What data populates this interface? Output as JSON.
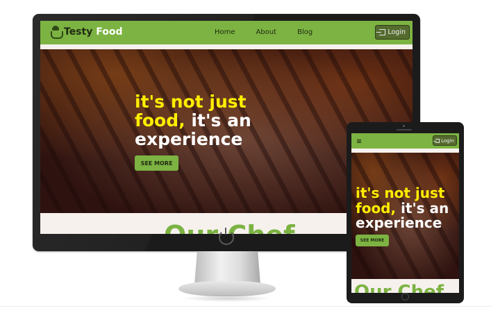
{
  "site": {
    "brand_primary": "Testy",
    "brand_highlight": "Food",
    "nav_links": [
      "Home",
      "About",
      "Blog"
    ],
    "login_label": "Login",
    "hero_line1": "it's not just",
    "hero_line2_highlight": "food,",
    "hero_line2_rest": "it's an",
    "hero_line3": "experience",
    "cta_label": "SEE MORE",
    "section_title": "Our Chef"
  },
  "colors": {
    "accent_green": "#7cb342",
    "login_button": "#556b2f",
    "highlight_yellow": "#ffee00",
    "device_frame": "#1b1b1b"
  },
  "icons": {
    "logo": "chef-hat-icon",
    "login": "login-icon",
    "power": "power-icon",
    "menu": "hamburger-menu-icon"
  }
}
